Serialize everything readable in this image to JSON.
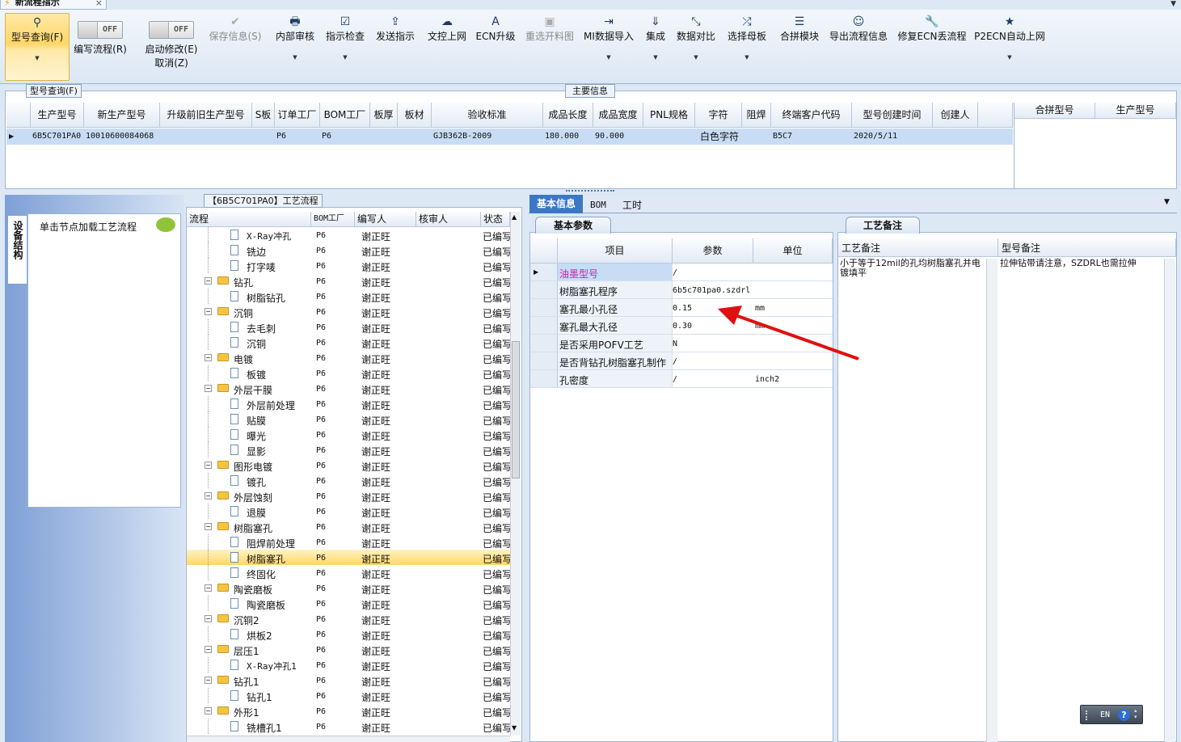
{
  "window": {
    "title": "新流程指示"
  },
  "ribbon": {
    "query": "型号查询(F)",
    "toggle_off": "OFF",
    "write_flow": "编写流程(R)",
    "start_modify": "启动修改(E)",
    "cancel": "取消(Z)",
    "items": [
      {
        "label": "保存信息(S)",
        "icon": "✔",
        "disabled": true,
        "dd": false
      },
      {
        "label": "内部审核",
        "icon": "🖶",
        "dd": true
      },
      {
        "label": "指示检查",
        "icon": "☑",
        "dd": true
      },
      {
        "label": "发送指示",
        "icon": "⇪",
        "dd": false
      },
      {
        "label": "文控上网",
        "icon": "☁",
        "dd": false
      },
      {
        "label": "ECN升级",
        "icon": "A",
        "dd": false
      },
      {
        "label": "重选开料图",
        "icon": "▣",
        "disabled": true,
        "dd": false
      },
      {
        "label": "MI数据导入",
        "icon": "⇥",
        "dd": true
      },
      {
        "label": "集成",
        "icon": "⇓",
        "dd": true
      },
      {
        "label": "数据对比",
        "icon": "⤡",
        "dd": true
      },
      {
        "label": "选择母板",
        "icon": "⤮",
        "dd": true
      },
      {
        "label": "合拼模块",
        "icon": "☰",
        "dd": false
      },
      {
        "label": "导出流程信息",
        "icon": "☺",
        "dd": false
      },
      {
        "label": "修复ECN丢流程",
        "icon": "🔧",
        "dd": false
      },
      {
        "label": "P2ECN自动上网",
        "icon": "★",
        "dd": true
      }
    ]
  },
  "main_info": {
    "search_tab": "型号查询(F)",
    "title": "主要信息",
    "columns": [
      "生产型号",
      "新生产型号",
      "升级前旧生产型号",
      "S板",
      "订单工厂",
      "BOM工厂",
      "板厚",
      "板材",
      "验收标准",
      "成品长度",
      "成品宽度",
      "PNL规格",
      "字符",
      "阻焊",
      "终端客户代码",
      "型号创建时间",
      "创建人"
    ],
    "row": [
      "6B5C701PA0",
      "10010600084068",
      "",
      "",
      "P6",
      "P6",
      "",
      "",
      "GJB362B-2009",
      "180.000",
      "90.000",
      "",
      "白色字符",
      "",
      "B5C7",
      "2020/5/11",
      ""
    ],
    "merge_columns": [
      "合拼型号",
      "生产型号"
    ]
  },
  "left_panel": {
    "vertical_tab": "设备结构",
    "hint": "单击节点加载工艺流程"
  },
  "flow": {
    "title": "【6B5C701PA0】工艺流程",
    "columns": [
      "流程",
      "BOM工厂",
      "编写人",
      "核审人",
      "状态"
    ],
    "rows": [
      {
        "name": "X-Ray冲孔",
        "level": 1,
        "factory": "P6",
        "writer": "谢正旺",
        "status": "已编写"
      },
      {
        "name": "铣边",
        "level": 1,
        "factory": "P6",
        "writer": "谢正旺",
        "status": "已编写"
      },
      {
        "name": "打字唛",
        "level": 1,
        "factory": "P6",
        "writer": "谢正旺",
        "status": "已编写"
      },
      {
        "name": "钻孔",
        "level": 0,
        "factory": "P6",
        "writer": "谢正旺",
        "status": "已编写"
      },
      {
        "name": "树脂钻孔",
        "level": 1,
        "factory": "P6",
        "writer": "谢正旺",
        "status": "已编写"
      },
      {
        "name": "沉铜",
        "level": 0,
        "factory": "P6",
        "writer": "谢正旺",
        "status": "已编写"
      },
      {
        "name": "去毛刺",
        "level": 1,
        "factory": "P6",
        "writer": "谢正旺",
        "status": "已编写"
      },
      {
        "name": "沉铜",
        "level": 1,
        "factory": "P6",
        "writer": "谢正旺",
        "status": "已编写"
      },
      {
        "name": "电镀",
        "level": 0,
        "factory": "P6",
        "writer": "谢正旺",
        "status": "已编写"
      },
      {
        "name": "板镀",
        "level": 1,
        "factory": "P6",
        "writer": "谢正旺",
        "status": "已编写"
      },
      {
        "name": "外层干膜",
        "level": 0,
        "factory": "P6",
        "writer": "谢正旺",
        "status": "已编写"
      },
      {
        "name": "外层前处理",
        "level": 1,
        "factory": "P6",
        "writer": "谢正旺",
        "status": "已编写"
      },
      {
        "name": "贴膜",
        "level": 1,
        "factory": "P6",
        "writer": "谢正旺",
        "status": "已编写"
      },
      {
        "name": "曝光",
        "level": 1,
        "factory": "P6",
        "writer": "谢正旺",
        "status": "已编写"
      },
      {
        "name": "显影",
        "level": 1,
        "factory": "P6",
        "writer": "谢正旺",
        "status": "已编写"
      },
      {
        "name": "图形电镀",
        "level": 0,
        "factory": "P6",
        "writer": "谢正旺",
        "status": "已编写"
      },
      {
        "name": "镀孔",
        "level": 1,
        "factory": "P6",
        "writer": "谢正旺",
        "status": "已编写"
      },
      {
        "name": "外层蚀刻",
        "level": 0,
        "factory": "P6",
        "writer": "谢正旺",
        "status": "已编写"
      },
      {
        "name": "退膜",
        "level": 1,
        "factory": "P6",
        "writer": "谢正旺",
        "status": "已编写"
      },
      {
        "name": "树脂塞孔",
        "level": 0,
        "factory": "P6",
        "writer": "谢正旺",
        "status": "已编写"
      },
      {
        "name": "阻焊前处理",
        "level": 1,
        "factory": "P6",
        "writer": "谢正旺",
        "status": "已编写"
      },
      {
        "name": "树脂塞孔",
        "level": 1,
        "factory": "P6",
        "writer": "谢正旺",
        "status": "已编写",
        "selected": true
      },
      {
        "name": "终固化",
        "level": 1,
        "factory": "P6",
        "writer": "谢正旺",
        "status": "已编写"
      },
      {
        "name": "陶瓷磨板",
        "level": 0,
        "factory": "P6",
        "writer": "谢正旺",
        "status": "已编写"
      },
      {
        "name": "陶瓷磨板",
        "level": 1,
        "factory": "P6",
        "writer": "谢正旺",
        "status": "已编写"
      },
      {
        "name": "沉铜2",
        "level": 0,
        "factory": "P6",
        "writer": "谢正旺",
        "status": "已编写"
      },
      {
        "name": "烘板2",
        "level": 1,
        "factory": "P6",
        "writer": "谢正旺",
        "status": "已编写"
      },
      {
        "name": "层压1",
        "level": 0,
        "factory": "P6",
        "writer": "谢正旺",
        "status": "已编写"
      },
      {
        "name": "X-Ray冲孔1",
        "level": 1,
        "factory": "P6",
        "writer": "谢正旺",
        "status": "已编写"
      },
      {
        "name": "钻孔1",
        "level": 0,
        "factory": "P6",
        "writer": "谢正旺",
        "status": "已编写"
      },
      {
        "name": "钻孔1",
        "level": 1,
        "factory": "P6",
        "writer": "谢正旺",
        "status": "已编写"
      },
      {
        "name": "外形1",
        "level": 0,
        "factory": "P6",
        "writer": "谢正旺",
        "status": "已编写"
      },
      {
        "name": "铣槽孔1",
        "level": 1,
        "factory": "P6",
        "writer": "谢正旺",
        "status": "已编写"
      }
    ]
  },
  "detail": {
    "tabs": [
      "基本信息",
      "BOM",
      "工时"
    ],
    "params_title": "基本参数",
    "params_columns": [
      "项目",
      "参数",
      "单位"
    ],
    "params": [
      {
        "item": "油墨型号",
        "value": "/",
        "unit": "",
        "highlight": true
      },
      {
        "item": "树脂塞孔程序",
        "value": "6b5c701pa0.szdrl",
        "unit": ""
      },
      {
        "item": "塞孔最小孔径",
        "value": "0.15",
        "unit": "mm"
      },
      {
        "item": "塞孔最大孔径",
        "value": "0.30",
        "unit": "mm"
      },
      {
        "item": "是否采用POFV工艺",
        "value": "N",
        "unit": ""
      },
      {
        "item": "是否背钻孔树脂塞孔制作",
        "value": "/",
        "unit": ""
      },
      {
        "item": "孔密度",
        "value": "/",
        "unit": "inch2"
      }
    ],
    "remarks_title": "工艺备注",
    "remarks_columns": [
      "工艺备注",
      "型号备注"
    ],
    "process_remark": "小于等于12mil的孔均树脂塞孔并电镀填平",
    "model_remark": "拉伸钻带请注意，SZDRL也需拉伸"
  },
  "ime": {
    "label": "EN"
  },
  "colors": {
    "accent": "#ffd766",
    "selected_row": "#c8dcf5",
    "arrow": "#e01010",
    "link": "#c026a8"
  }
}
